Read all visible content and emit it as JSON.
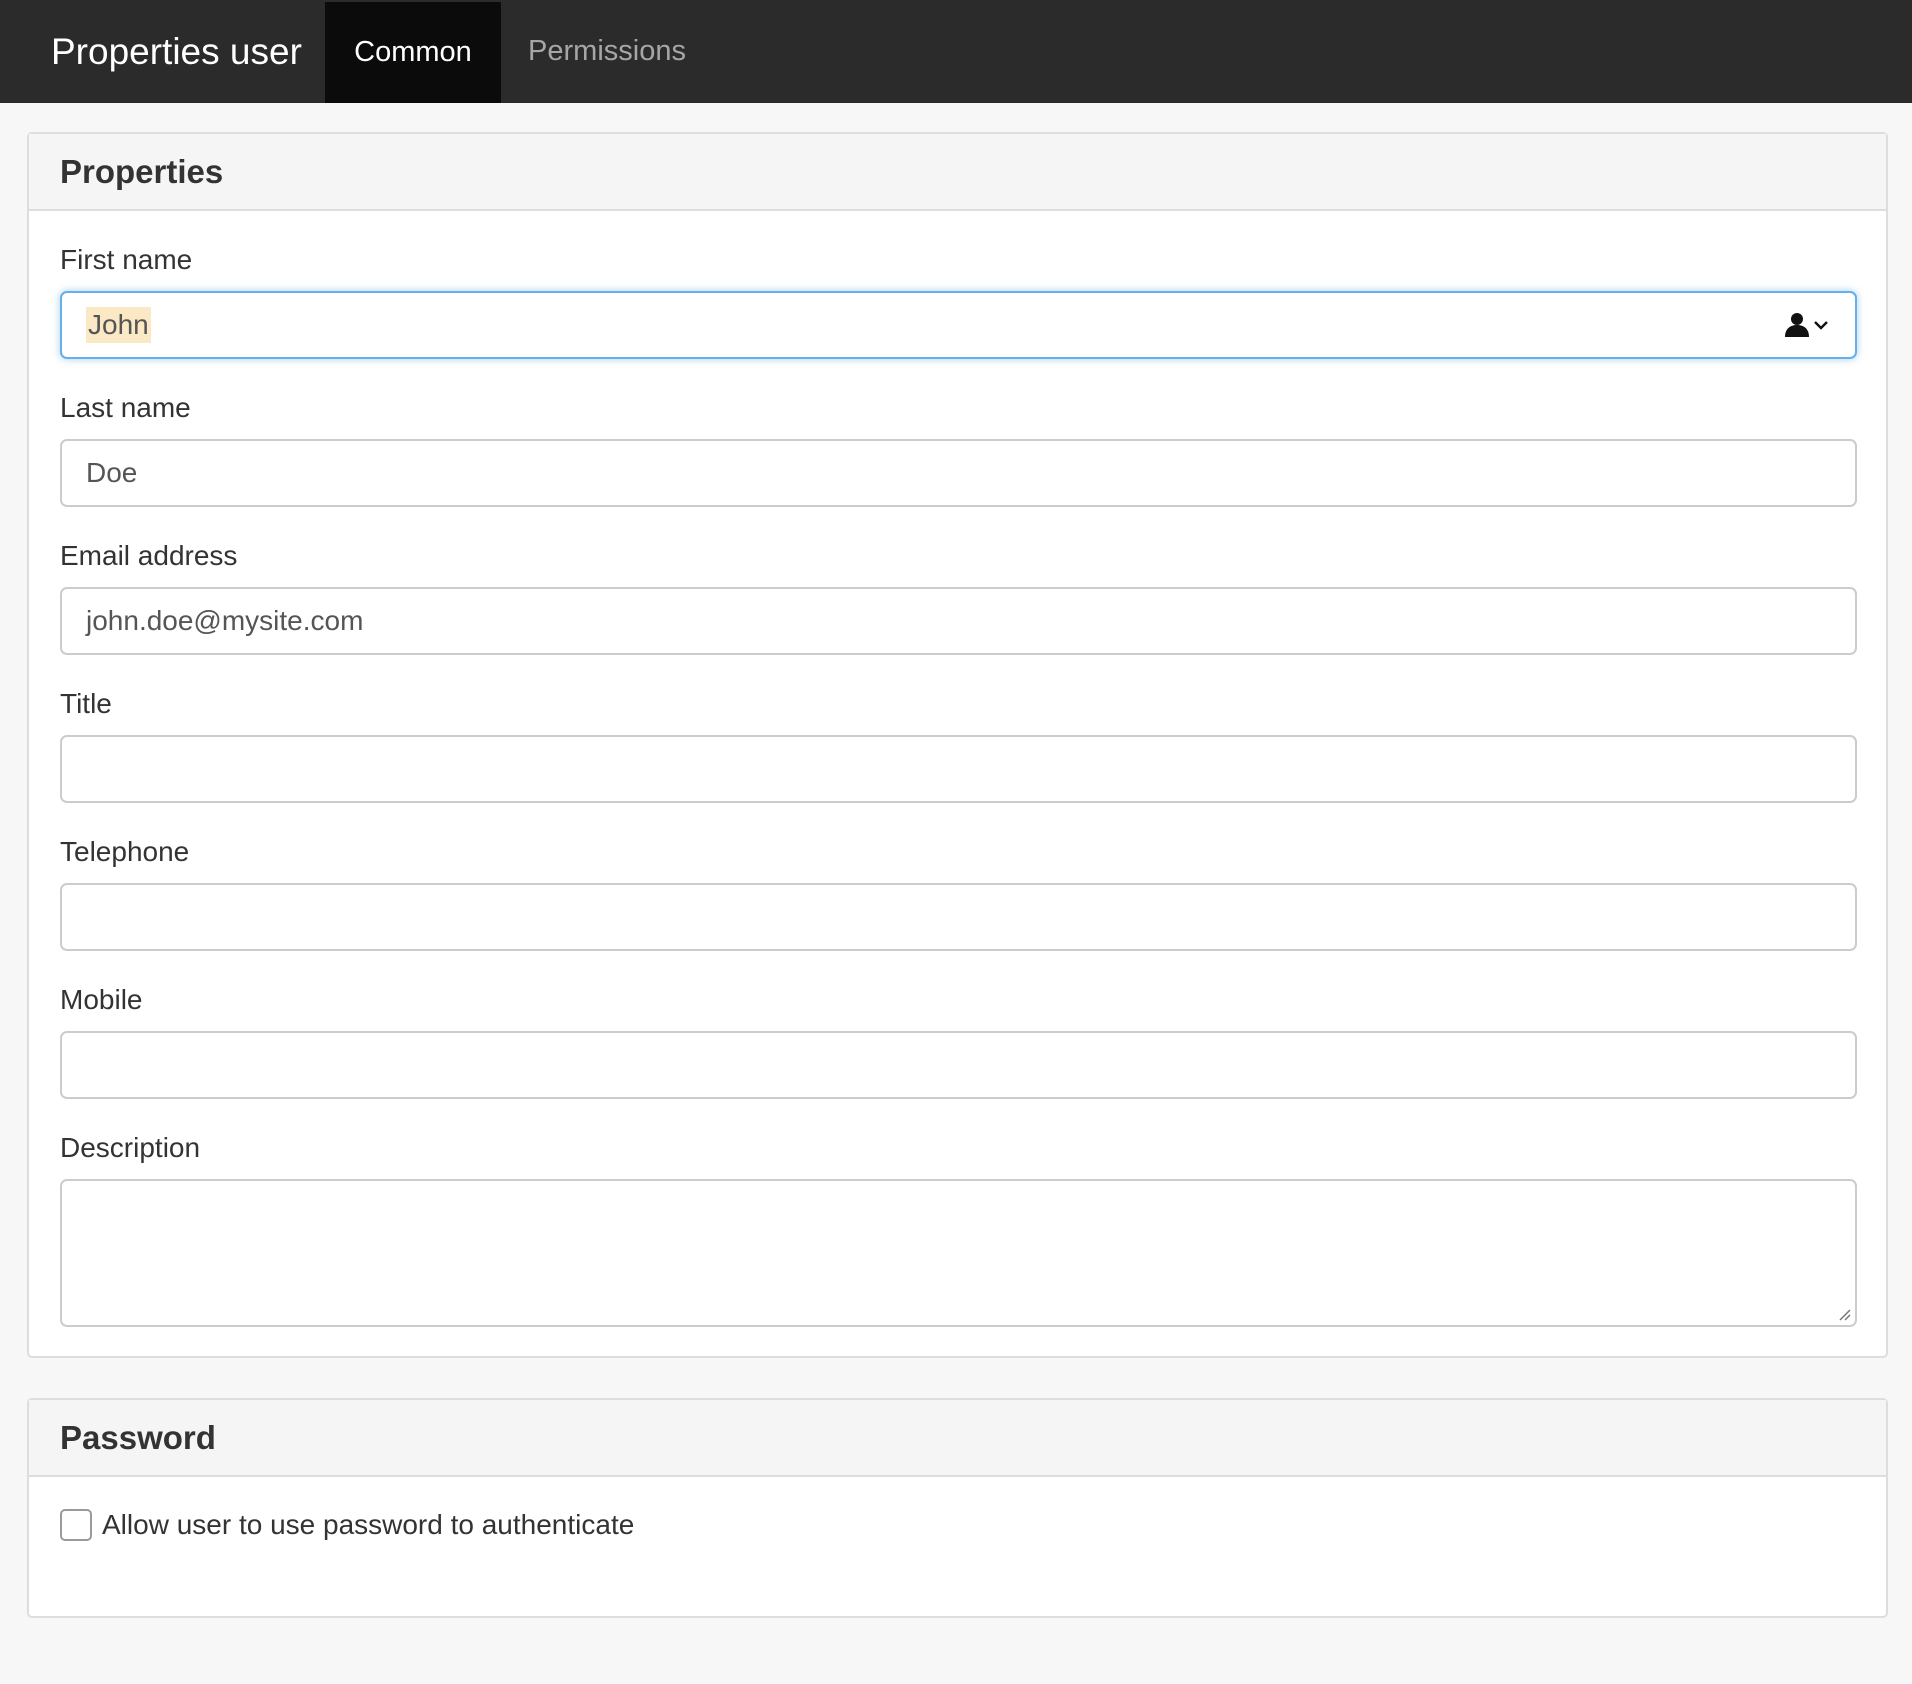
{
  "header": {
    "title": "Properties user",
    "tabs": [
      {
        "label": "Common",
        "active": true
      },
      {
        "label": "Permissions",
        "active": false
      }
    ]
  },
  "properties": {
    "heading": "Properties",
    "fields": {
      "first_name": {
        "label": "First name",
        "value": "John"
      },
      "last_name": {
        "label": "Last name",
        "value": "Doe"
      },
      "email": {
        "label": "Email address",
        "value": "john.doe@mysite.com"
      },
      "title": {
        "label": "Title",
        "value": ""
      },
      "telephone": {
        "label": "Telephone",
        "value": ""
      },
      "mobile": {
        "label": "Mobile",
        "value": ""
      },
      "description": {
        "label": "Description",
        "value": ""
      }
    }
  },
  "password": {
    "heading": "Password",
    "checkbox_label": "Allow user to use password to authenticate",
    "checked": false
  },
  "icons": {
    "autofill": "contact-autofill-icon",
    "autofill_chevron": "chevron-down-icon",
    "resize": "resize-grip-icon"
  },
  "colors": {
    "topbar": "#2b2b2b",
    "active_tab": "#0b0b0b",
    "focus_border": "#66afe9",
    "highlight": "#fbe8c4"
  }
}
